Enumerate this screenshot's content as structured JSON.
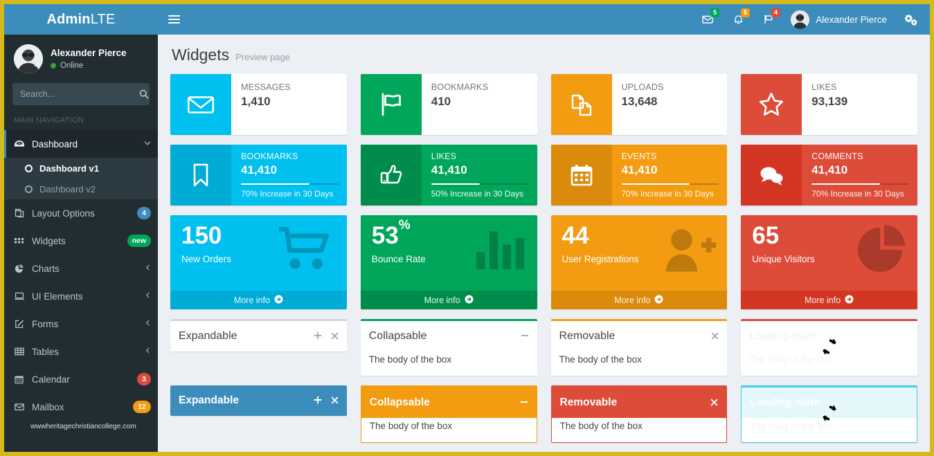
{
  "brand": {
    "bold": "Admin",
    "light": "LTE"
  },
  "user_panel": {
    "name": "Alexander Pierce",
    "status": "Online"
  },
  "search": {
    "placeholder": "Search...",
    "value": "",
    "icon": "search-icon"
  },
  "sidebar": {
    "header": "MAIN NAVIGATION",
    "items": [
      {
        "label": "Dashboard",
        "icon": "dashboard-icon",
        "arrow": "chevron-down-icon",
        "active": true
      },
      {
        "label": "Layout Options",
        "icon": "layers-icon",
        "badge": "4",
        "badge_color": "blue"
      },
      {
        "label": "Widgets",
        "icon": "grid-icon",
        "badge": "new",
        "badge_color": "green"
      },
      {
        "label": "Charts",
        "icon": "pie-chart-icon",
        "arrow": "chevron-left-icon"
      },
      {
        "label": "UI Elements",
        "icon": "laptop-icon",
        "arrow": "chevron-left-icon"
      },
      {
        "label": "Forms",
        "icon": "edit-icon",
        "arrow": "chevron-left-icon"
      },
      {
        "label": "Tables",
        "icon": "table-icon",
        "arrow": "chevron-left-icon"
      },
      {
        "label": "Calendar",
        "icon": "calendar-icon",
        "badge": "3",
        "badge_color": "red"
      },
      {
        "label": "Mailbox",
        "icon": "envelope-icon",
        "badge": "12",
        "badge_color": "yellow"
      }
    ],
    "subitems": [
      {
        "label": "Dashboard v1",
        "active": true
      },
      {
        "label": "Dashboard v2",
        "active": false
      }
    ],
    "watermark": "wwwheritagechristiancollege.com"
  },
  "navbar": {
    "toggle": "hamburger-icon",
    "icons": [
      {
        "name": "envelope-icon",
        "badge": "5",
        "color": "green"
      },
      {
        "name": "bell-icon",
        "badge": "5",
        "color": "yellow"
      },
      {
        "name": "flag-icon",
        "badge": "4",
        "color": "red"
      }
    ],
    "user_name": "Alexander Pierce",
    "settings_icon": "gears-icon"
  },
  "page": {
    "title": "Widgets",
    "subtitle": "Preview page"
  },
  "info_boxes": [
    {
      "text": "MESSAGES",
      "number": "1,410",
      "icon": "envelope-icon",
      "color": "#00c0ef"
    },
    {
      "text": "BOOKMARKS",
      "number": "410",
      "icon": "flag-icon",
      "color": "#00a65a"
    },
    {
      "text": "UPLOADS",
      "number": "13,648",
      "icon": "files-icon",
      "color": "#f39c12"
    },
    {
      "text": "LIKES",
      "number": "93,139",
      "icon": "star-icon",
      "color": "#dd4b39"
    }
  ],
  "info_boxes_progress": [
    {
      "text": "BOOKMARKS",
      "number": "41,410",
      "icon": "bookmark-icon",
      "desc": "70% Increase in 30 Days",
      "progress": 70,
      "color": "#00c0ef",
      "icon_bg": "#00acd6"
    },
    {
      "text": "LIKES",
      "number": "41,410",
      "icon": "thumbs-up-icon",
      "desc": "50% Increase in 30 Days",
      "progress": 50,
      "color": "#00a65a",
      "icon_bg": "#008d4c"
    },
    {
      "text": "EVENTS",
      "number": "41,410",
      "icon": "calendar-icon",
      "desc": "70% Increase in 30 Days",
      "progress": 70,
      "color": "#f39c12",
      "icon_bg": "#db8b0b"
    },
    {
      "text": "COMMENTS",
      "number": "41,410",
      "icon": "comments-icon",
      "desc": "70% Increase in 30 Days",
      "progress": 70,
      "color": "#dd4b39",
      "icon_bg": "#d33724"
    }
  ],
  "small_boxes": [
    {
      "number": "150",
      "suffix": "",
      "text": "New Orders",
      "footer": "More info",
      "icon": "shopping-cart-icon",
      "color": "#00c0ef",
      "footer_color": "#00acd6"
    },
    {
      "number": "53",
      "suffix": "%",
      "text": "Bounce Rate",
      "footer": "More info",
      "icon": "bar-chart-icon",
      "color": "#00a65a",
      "footer_color": "#008d4c"
    },
    {
      "number": "44",
      "suffix": "",
      "text": "User Registrations",
      "footer": "More info",
      "icon": "user-plus-icon",
      "color": "#f39c12",
      "footer_color": "#db8b0b"
    },
    {
      "number": "65",
      "suffix": "",
      "text": "Unique Visitors",
      "footer": "More info",
      "icon": "pie-chart-icon",
      "color": "#dd4b39",
      "footer_color": "#d33724"
    }
  ],
  "boxes_plain": [
    {
      "title": "Expandable",
      "body": "",
      "tools": [
        "plus-icon",
        "close-icon"
      ],
      "border_color": "#d2d6de",
      "collapsed": true
    },
    {
      "title": "Collapsable",
      "body": "The body of the box",
      "tools": [
        "minus-icon"
      ],
      "border_color": "#00a65a",
      "collapsed": false
    },
    {
      "title": "Removable",
      "body": "The body of the box",
      "tools": [
        "close-icon"
      ],
      "border_color": "#f39c12",
      "collapsed": false
    },
    {
      "title": "Loading state",
      "body": "The body of the box",
      "tools": [],
      "border_color": "#dd4b39",
      "collapsed": false,
      "loading": true,
      "spinner_icon": "refresh-icon"
    }
  ],
  "boxes_solid": [
    {
      "title": "Expandable",
      "body": "",
      "tools": [
        "plus-icon",
        "close-icon"
      ],
      "color": "#3c8dbc",
      "collapsed": true
    },
    {
      "title": "Collapsable",
      "body": "The body of the box",
      "tools": [
        "minus-icon"
      ],
      "color": "#f39c12",
      "collapsed": false
    },
    {
      "title": "Removable",
      "body": "The body of the box",
      "tools": [
        "close-icon"
      ],
      "color": "#dd4b39",
      "collapsed": false
    },
    {
      "title": "Loading state",
      "body": "The body of the box",
      "tools": [],
      "color": "#9fe7f5",
      "collapsed": false,
      "loading": true,
      "spinner_icon": "refresh-icon"
    }
  ],
  "icons": {
    "plus": "+",
    "minus": "−",
    "close": "✖",
    "spinner": "↻",
    "arrow_circle": "➔",
    "chevron_down": "⌄",
    "chevron_left": "‹"
  }
}
